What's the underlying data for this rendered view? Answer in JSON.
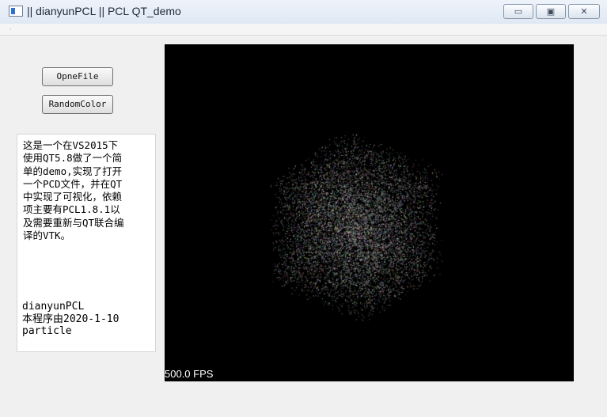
{
  "window": {
    "title": "|| dianyunPCL || PCL QT_demo",
    "controls": {
      "minimize": "▭",
      "maximize": "▣",
      "close": "✕"
    }
  },
  "toolbar": {
    "open_file_label": "OpneFile",
    "random_color_label": "RandomColor"
  },
  "textbox": {
    "paragraph_lines": [
      "这是一个在VS2015下",
      "使用QT5.8做了一个简",
      "单的demo,实现了打开",
      "一个PCD文件，并在QT",
      "中实现了可视化，依赖",
      "项主要有PCL1.8.1以",
      "及需要重新与QT联合编",
      "译的VTK。"
    ],
    "bottom_lines": [
      "dianyunPCL",
      "本程序由2020-1-10",
      "particle"
    ]
  },
  "viewer": {
    "fps_label": "500.0 FPS",
    "background": "#000000"
  },
  "colors": {
    "window_bg": "#f0f0f0",
    "viewer_bg": "#000000"
  }
}
